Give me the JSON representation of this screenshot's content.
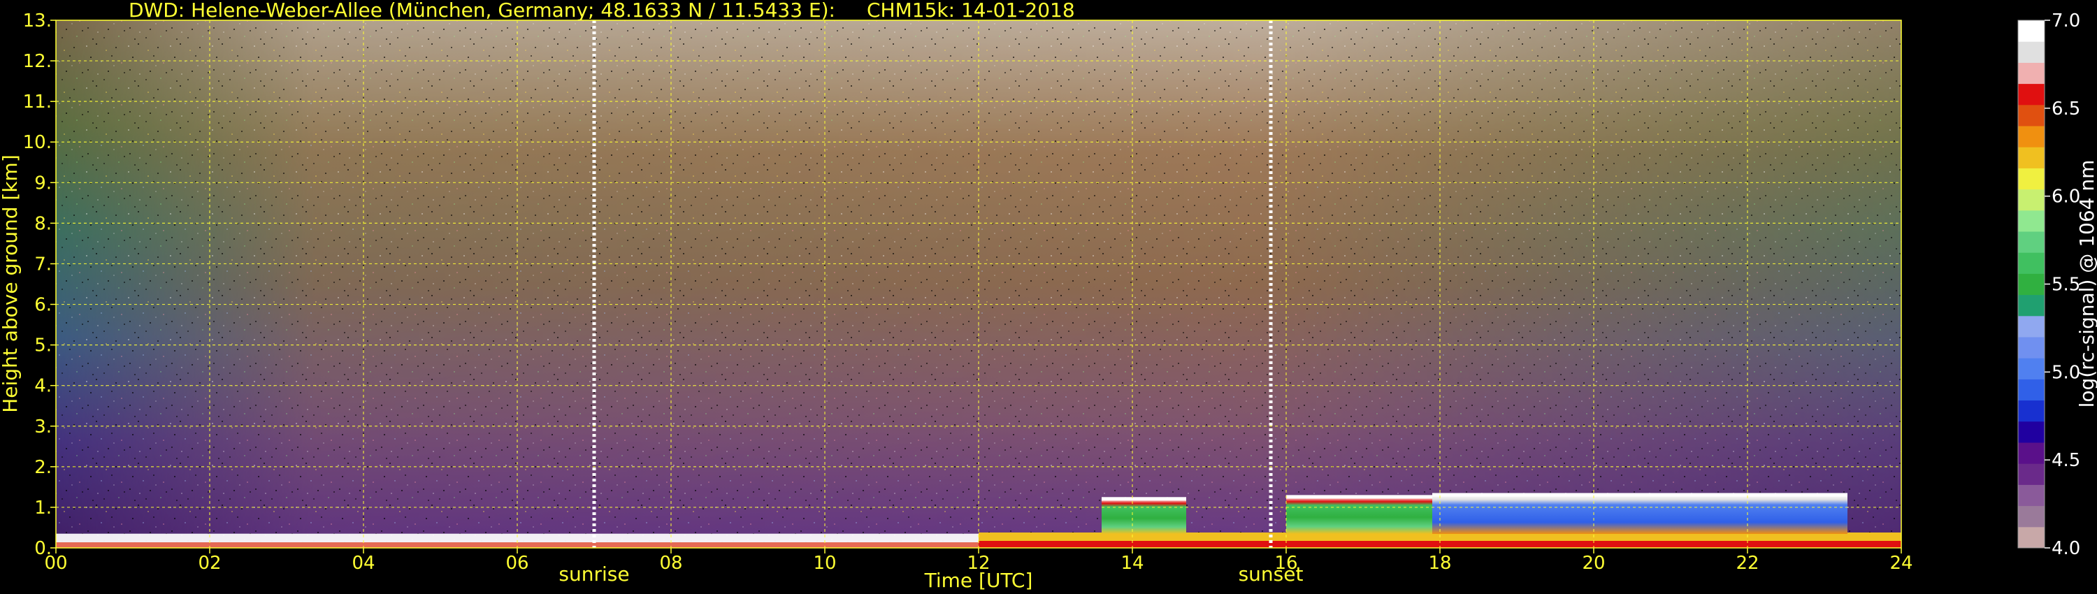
{
  "chart_data": {
    "type": "heatmap",
    "title_left": "DWD: Helene-Weber-Allee (München, Germany; 48.1633 N / 11.5433 E):",
    "title_right": "CHM15k: 14-01-2018",
    "xlabel": "Time [UTC]",
    "ylabel": "Height above ground [km]",
    "xlim": [
      0,
      24
    ],
    "ylim": [
      0,
      13
    ],
    "x_ticks": [
      "00",
      "02",
      "04",
      "06",
      "08",
      "10",
      "12",
      "14",
      "16",
      "18",
      "20",
      "22",
      "24"
    ],
    "y_ticks": [
      "0.",
      "1.",
      "2.",
      "3.",
      "4.",
      "5.",
      "6.",
      "7.",
      "8.",
      "9.",
      "10.",
      "11.",
      "12.",
      "13."
    ],
    "grid": true,
    "annotations": [
      {
        "label": "sunrise",
        "time": 7.0
      },
      {
        "label": "sunset",
        "time": 15.8
      }
    ],
    "colorbar": {
      "label": "log(rc-signal) @ 1064 nm",
      "range": [
        4.0,
        7.0
      ],
      "ticks": [
        "4.0",
        "4.5",
        "5.0",
        "5.5",
        "6.0",
        "6.5",
        "7.0"
      ],
      "colors": [
        "#c8a8a8",
        "#9a7a9a",
        "#8a5a9a",
        "#6a2a8a",
        "#5a108a",
        "#2000a0",
        "#1830d0",
        "#3060e8",
        "#5080f0",
        "#7090f0",
        "#90a8f0",
        "#20a070",
        "#30b040",
        "#40c060",
        "#60d080",
        "#90e890",
        "#c8f070",
        "#f0f040",
        "#f0c020",
        "#f09010",
        "#e05010",
        "#e01010",
        "#f0b0b0",
        "#e0e0e0",
        "#ffffff"
      ]
    },
    "cloud_segments": [
      {
        "start": 13.6,
        "end": 14.7,
        "height_km": 1.2
      },
      {
        "start": 16.0,
        "end": 17.9,
        "height_km": 1.25
      },
      {
        "start": 17.9,
        "end": 23.3,
        "height_km": 1.3
      }
    ]
  }
}
